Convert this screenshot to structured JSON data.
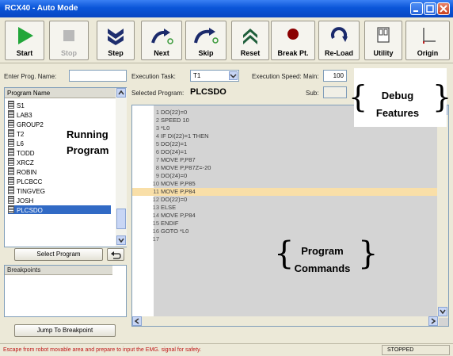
{
  "window": {
    "title": "RCX40 - Auto Mode"
  },
  "toolbar": {
    "start": "Start",
    "stop": "Stop",
    "step": "Step",
    "next": "Next",
    "skip": "Skip",
    "reset": "Reset",
    "break_pt": "Break Pt.",
    "reload": "Re-Load",
    "utility": "Utility",
    "origin": "Origin"
  },
  "left": {
    "enter_prog_label": "Enter Prog. Name:",
    "enter_prog_value": "",
    "program_list_header": "Program Name",
    "programs": [
      "S1",
      "LAB3",
      "GROUP2",
      "T2",
      "L6",
      "TODD",
      "XRCZ",
      "ROBIN",
      "PLCBCC",
      "TINGVEG",
      "JOSH",
      "PLCSDO"
    ],
    "selected_program_index": 11,
    "select_program_button": "Select Program",
    "breakpoints_header": "Breakpoints",
    "jump_button": "Jump To Breakpoint"
  },
  "exec": {
    "task_label": "Execution Task:",
    "task_value": "T1",
    "speed_label": "Execution Speed:",
    "main_label": "Main:",
    "main_value": "100",
    "sub_label": "Sub:",
    "sub_value": "",
    "selected_program_label": "Selected Program:",
    "selected_program_value": "PLCSDO"
  },
  "code": {
    "lines": [
      {
        "n": "1",
        "t": "DO(22)=0"
      },
      {
        "n": "2",
        "t": "SPEED 10"
      },
      {
        "n": "3",
        "t": "*L0"
      },
      {
        "n": "4",
        "t": "IF DI(22)=1 THEN"
      },
      {
        "n": "5",
        "t": "DO(22)=1"
      },
      {
        "n": "6",
        "t": "DO(24)=1"
      },
      {
        "n": "7",
        "t": "MOVE P,P87"
      },
      {
        "n": "8",
        "t": "MOVE P,P87Z=-20"
      },
      {
        "n": "9",
        "t": "DO(24)=0"
      },
      {
        "n": "10",
        "t": "MOVE P,P85"
      },
      {
        "n": "11",
        "t": "MOVE P,P84"
      },
      {
        "n": "12",
        "t": "DO(22)=0"
      },
      {
        "n": "13",
        "t": "ELSE"
      },
      {
        "n": "14",
        "t": "MOVE P,P84"
      },
      {
        "n": "15",
        "t": "ENDIF"
      },
      {
        "n": "16",
        "t": "GOTO *L0"
      },
      {
        "n": "17",
        "t": ""
      }
    ],
    "highlight_line": 11
  },
  "status": {
    "message": "Escape from robot movable area and prepare to input the EMG. signal for safety.",
    "state": "STOPPED"
  },
  "annotations": {
    "running_program": [
      "Running",
      "Program"
    ],
    "debug_features": [
      "Debug",
      "Features"
    ],
    "program_commands": [
      "Program",
      "Commands"
    ]
  },
  "colors": {
    "title_bar": "#0a55d8",
    "start_icon": "#22a63a",
    "highlight_line": "#f9dfa8",
    "breakpoint_icon": "#8b0000",
    "selection": "#316ac5"
  }
}
